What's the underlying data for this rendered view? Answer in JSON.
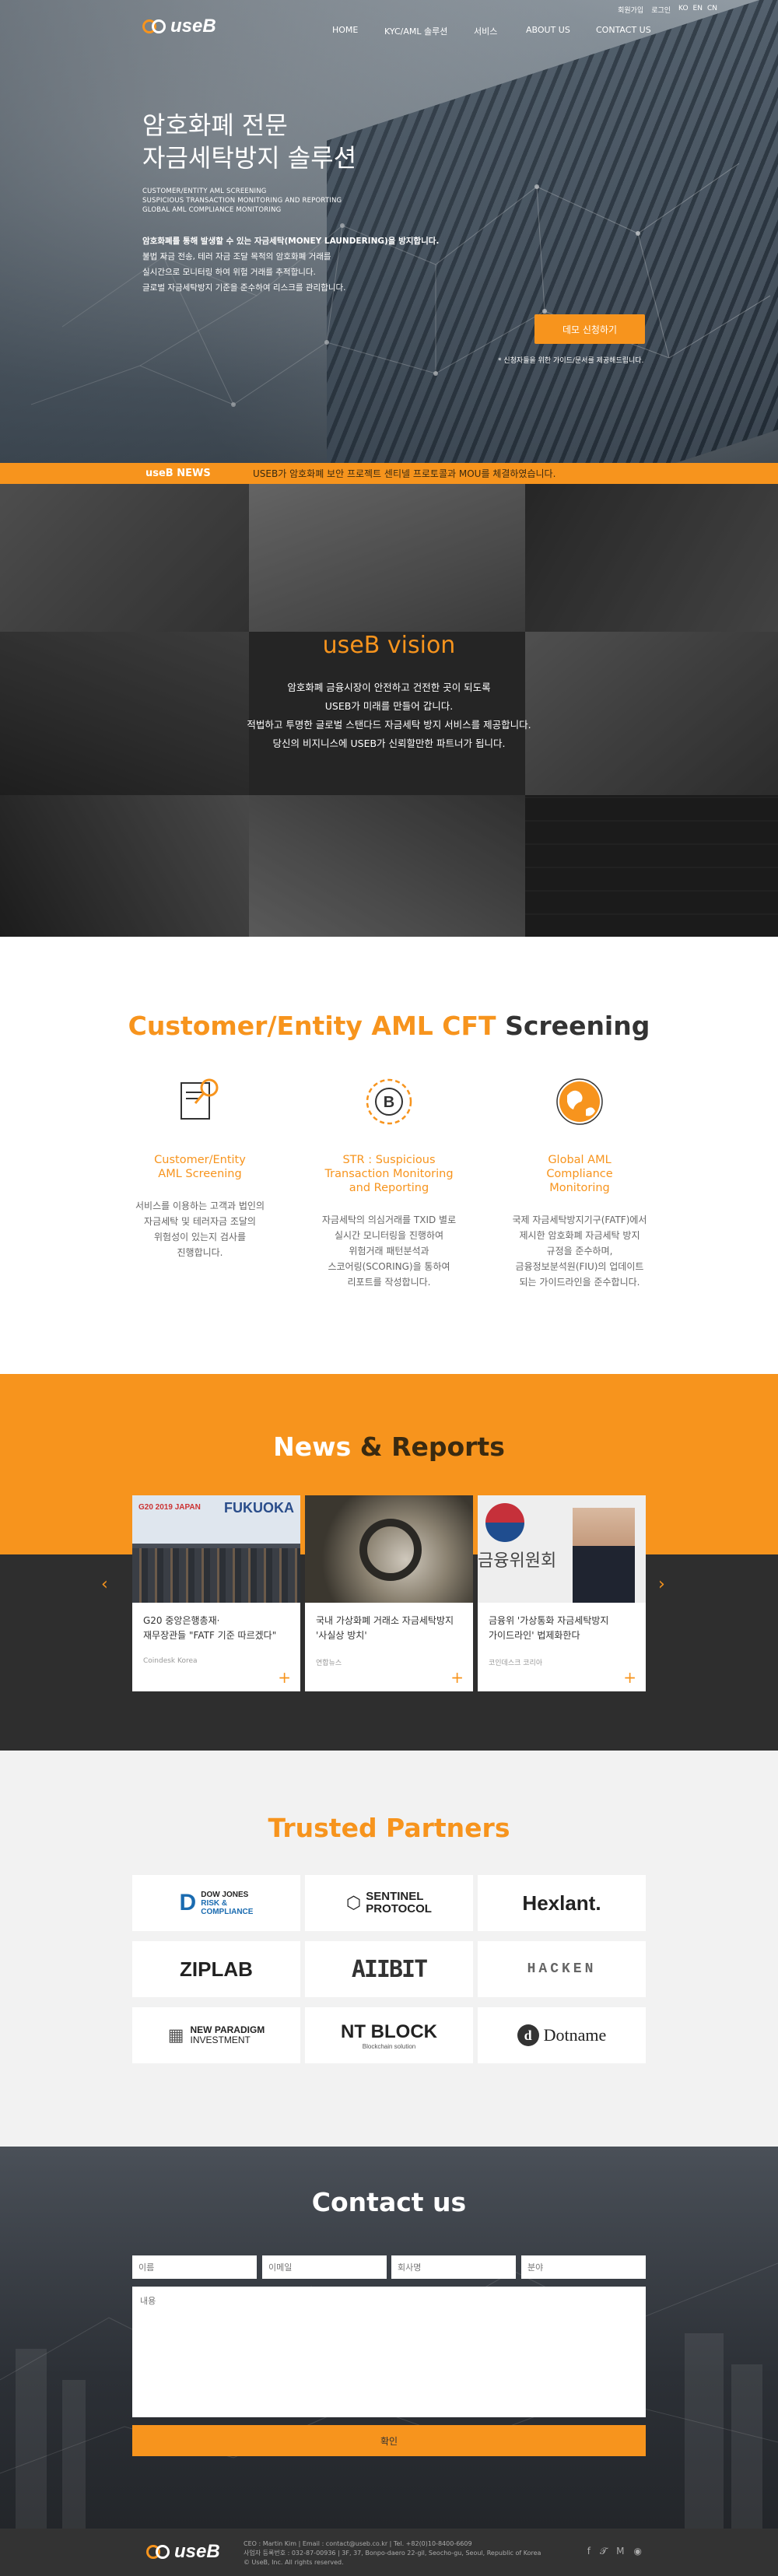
{
  "header": {
    "util_links": [
      "회원가입",
      "로그인"
    ],
    "langs": [
      "KO",
      "EN",
      "CN"
    ],
    "logo_text": "useB",
    "nav": [
      "HOME",
      "KYC/AML 솔루션",
      "서비스",
      "ABOUT US",
      "CONTACT US"
    ]
  },
  "hero": {
    "title_line1": "암호화폐 전문",
    "title_line2": "자금세탁방지 솔루션",
    "sub1": "CUSTOMER/ENTITY AML SCREENING",
    "sub2": "SUSPICIOUS TRANSACTION MONITORING AND REPORTING",
    "sub3": "GLOBAL AML COMPLIANCE MONITORING",
    "desc1": "암호화폐를 통해 발생할 수 있는 자금세탁(MONEY LAUNDERING)을 방지합니다.",
    "desc2": "불법 자금 전송, 테러 자금 조달 목적의 암호화폐 거래를",
    "desc3": "실시간으로 모니터링 하여 위험 거래를 추적합니다.",
    "desc4": "글로벌 자금세탁방지 기준을 준수하여 리스크를 관리합니다.",
    "demo_button": "데모 신청하기",
    "note": "* 신청자들을 위한 가이드/문서를 제공해드립니다."
  },
  "ticker": {
    "label": "useB NEWS",
    "message": "USEB가 암호화폐 보안 프로젝트 센티넬 프로토콜과 MOU를 체결하였습니다."
  },
  "vision": {
    "title": "useB vision",
    "line1": "암호화폐 금융시장이 안전하고 건전한 곳이 되도록",
    "line2": "USEB가 미래를 만들어 갑니다.",
    "line3": "적법하고 투명한 글로벌 스탠다드 자금세탁 방지 서비스를 제공합니다.",
    "line4": "당신의 비지니스에 USEB가 신뢰할만한 파트너가 됩니다."
  },
  "services": {
    "title_orange": "Customer/Entity AML CFT",
    "title_dark": "Screening",
    "items": [
      {
        "icon": "document-search-icon",
        "title1": "Customer/Entity",
        "title2": "AML Screening",
        "title3": "",
        "d1": "서비스를 이용하는 고객과 법인의",
        "d2": "자금세탁 및 테러자금 조달의",
        "d3": "위험성이 있는지 검사를",
        "d4": "진행합니다.",
        "d5": ""
      },
      {
        "icon": "bitcoin-monitor-icon",
        "title1": "STR : Suspicious",
        "title2": "Transaction Monitoring",
        "title3": "and Reporting",
        "d1": "자금세탁의 의심거래를 TXID 별로",
        "d2": "실시간 모니터링을 진행하여",
        "d3": "위험거래 패턴분석과",
        "d4": "스코어링(SCORING)을 통하여",
        "d5": "리포트를 작성합니다."
      },
      {
        "icon": "globe-icon",
        "title1": "Global AML",
        "title2": "Compliance",
        "title3": "Monitoring",
        "d1": "국제 자금세탁방지기구(FATF)에서",
        "d2": "제시한 암호화폐 자금세탁 방지",
        "d3": "규정을 준수하며,",
        "d4": "금융정보분석원(FIU)의 업데이트",
        "d5": "되는 가이드라인을 준수합니다."
      }
    ]
  },
  "news": {
    "title_light": "News",
    "title_amp": "&",
    "title_dark": "Reports",
    "cards": [
      {
        "title1": "G20 중앙은행총재·",
        "title2": "재무장관들 \"FATF 기준 따르겠다\"",
        "source": "Coindesk Korea"
      },
      {
        "title1": "국내 가상화폐 거래소 자금세탁방지",
        "title2": "'사실상 방치'",
        "source": "연합뉴스"
      },
      {
        "title1": "금융위 '가상통화 자금세탁방지",
        "title2": "가이드라인' 법제화한다",
        "source": "코인데스크 코리아"
      }
    ],
    "fukuoka": "FUKUOKA",
    "g20": "G20 2019 JAPAN",
    "fsc": "금융위원회"
  },
  "partners": {
    "title": "Trusted Partners",
    "logos": [
      {
        "l1": "DOW JONES",
        "l2": "RISK &",
        "l3": "COMPLIANCE"
      },
      {
        "l1": "SENTINEL",
        "l2": "PROTOCOL"
      },
      {
        "l1": "Hexlant."
      },
      {
        "l1": "ZIPLAB"
      },
      {
        "l1": "AIIBIT"
      },
      {
        "l1": "HACKEN"
      },
      {
        "l1": "NEW PARADIGM",
        "l2": "INVESTMENT"
      },
      {
        "l1": "NT BLOCK",
        "l2": "Blockchain solution"
      },
      {
        "l1": "Dotname"
      }
    ]
  },
  "contact": {
    "title": "Contact us",
    "ph_name": "이름",
    "ph_email": "이메일",
    "ph_company": "회사명",
    "ph_field": "분야",
    "ph_message": "내용",
    "submit": "확인"
  },
  "footer": {
    "line1": "CEO : Martin Kim  |  Email : contact@useb.co.kr  |  Tel. +82(0)10-8400-6609",
    "line2": "사업자 등록번호 : 032-87-00936  |  3F, 37, Bonpo-daero 22-gil, Seocho-gu, Seoul, Republic of Korea",
    "line3": "© UseB, Inc. All rights reserved."
  },
  "colors": {
    "accent": "#f7941d",
    "dark": "#2e2e2e",
    "light_bg": "#f2f2f2"
  }
}
